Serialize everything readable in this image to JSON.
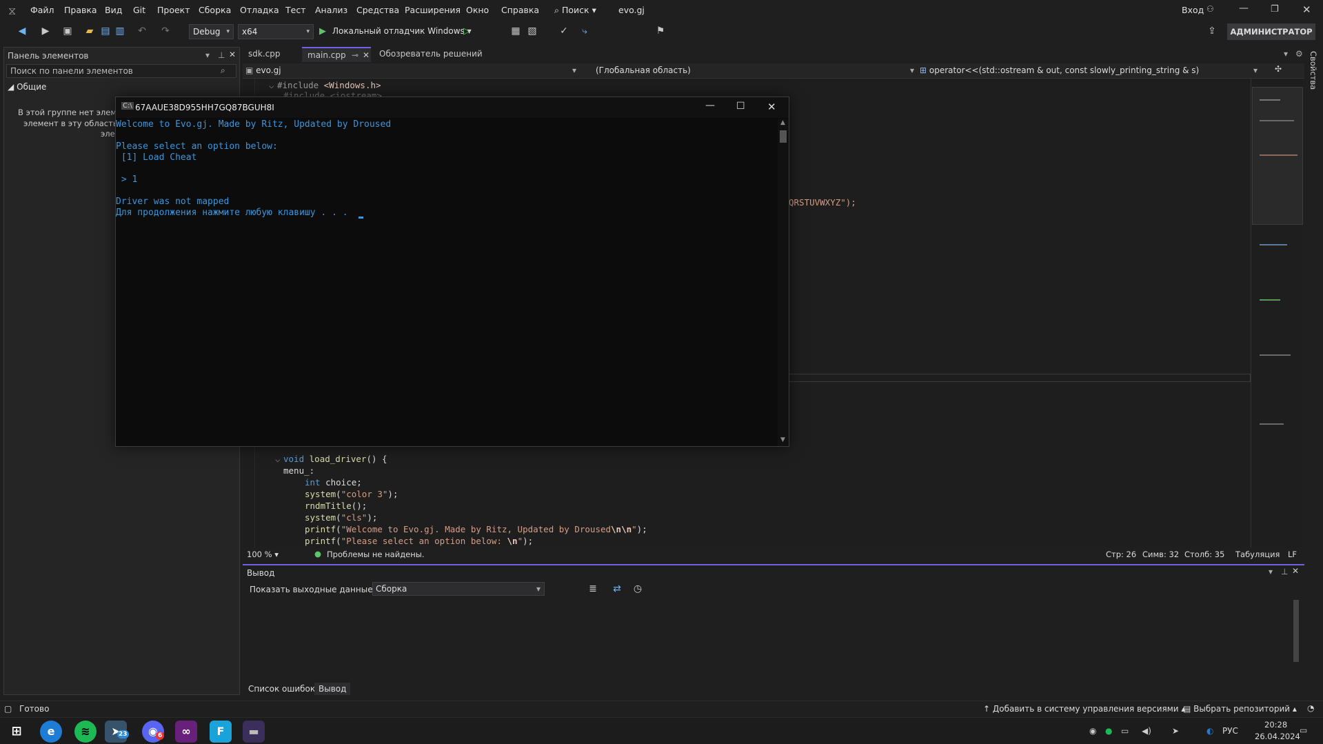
{
  "menu": {
    "items": [
      "Файл",
      "Правка",
      "Вид",
      "Git",
      "Проект",
      "Сборка",
      "Отладка",
      "Тест",
      "Анализ",
      "Средства",
      "Расширения",
      "Окно",
      "Справка"
    ],
    "search_label": "Поиск",
    "solution_name": "evo.gj",
    "login": "Вход"
  },
  "toolbar": {
    "config": "Debug",
    "platform": "x64",
    "run_label": "Локальный отладчик Windows",
    "admin_label": "АДМИНИСТРАТОР"
  },
  "toolbox": {
    "title": "Панель элементов",
    "search_placeholder": "Поиск по панели элементов",
    "group": "Общие",
    "empty_lines": [
      "В этой группе нет элемен",
      "элемент в эту область, ч",
      "эле"
    ]
  },
  "tabs": [
    {
      "label": "sdk.cpp"
    },
    {
      "label": "main.cpp"
    },
    {
      "label": "Обозреватель решений"
    }
  ],
  "navbar": {
    "project": "evo.gj",
    "scope": "(Глобальная область)",
    "member": "operator<<(std::ostream & out, const slowly_printing_string & s)"
  },
  "code": {
    "line1_directive": "#include ",
    "line1_header": "<Windows.h>",
    "line2": "#include <iostream>",
    "alphabet_tail": "QRSTUVWXYZ\");",
    "fn_kw": "void",
    "fn_name": "load_driver",
    "fn_rest": "() {",
    "label": "menu_:",
    "l_int_kw": "int",
    "l_int_var": " choice;",
    "l_sys1_fn": "system",
    "l_sys1_str": "\"color 3\"",
    "l_rndm": "rndmTitle",
    "l_sys2_str": "\"cls\"",
    "l_printf": "printf",
    "l_printf1_str": "\"Welcome to Evo.gj. Made by Ritz, Updated by Droused",
    "l_printf1_esc": "\\n\\n",
    "l_printf2_str": "\"Please select an option below: ",
    "l_printf2_esc": "\\n"
  },
  "editor_status": {
    "zoom": "100 %",
    "issues": "Проблемы не найдены.",
    "line": "Стр: 26",
    "char": "Симв: 32",
    "col": "Столб: 35",
    "tab": "Табуляция",
    "eol": "LF"
  },
  "output": {
    "title": "Вывод",
    "show_from": "Показать выходные данные из:",
    "source": "Сборка"
  },
  "bottom_tabs": [
    "Список ошибок",
    "Вывод"
  ],
  "console": {
    "title": "67AAUE38D955HH7GQ87BGUH8I",
    "lines": [
      "Welcome to Evo.gj. Made by Ritz, Updated by Droused",
      "",
      "Please select an option below:",
      " [1] Load Cheat",
      "",
      " > 1",
      "",
      "Driver was not mapped",
      "Для продолжения нажмите любую клавишу . . ."
    ]
  },
  "statusbar": {
    "ready": "Готово",
    "add_vcs": "Добавить в систему управления версиями",
    "select_repo": "Выбрать репозиторий"
  },
  "right_panel": {
    "label": "Свойства"
  },
  "taskbar": {
    "telegram_badge": "23",
    "discord_badge": "6",
    "lang": "РУС",
    "time": "20:28",
    "date": "26.04.2024"
  },
  "colors": {
    "accent": "#7160e8",
    "console_text": "#3a96dd",
    "keyword": "#569cd6",
    "string": "#d69d85"
  }
}
